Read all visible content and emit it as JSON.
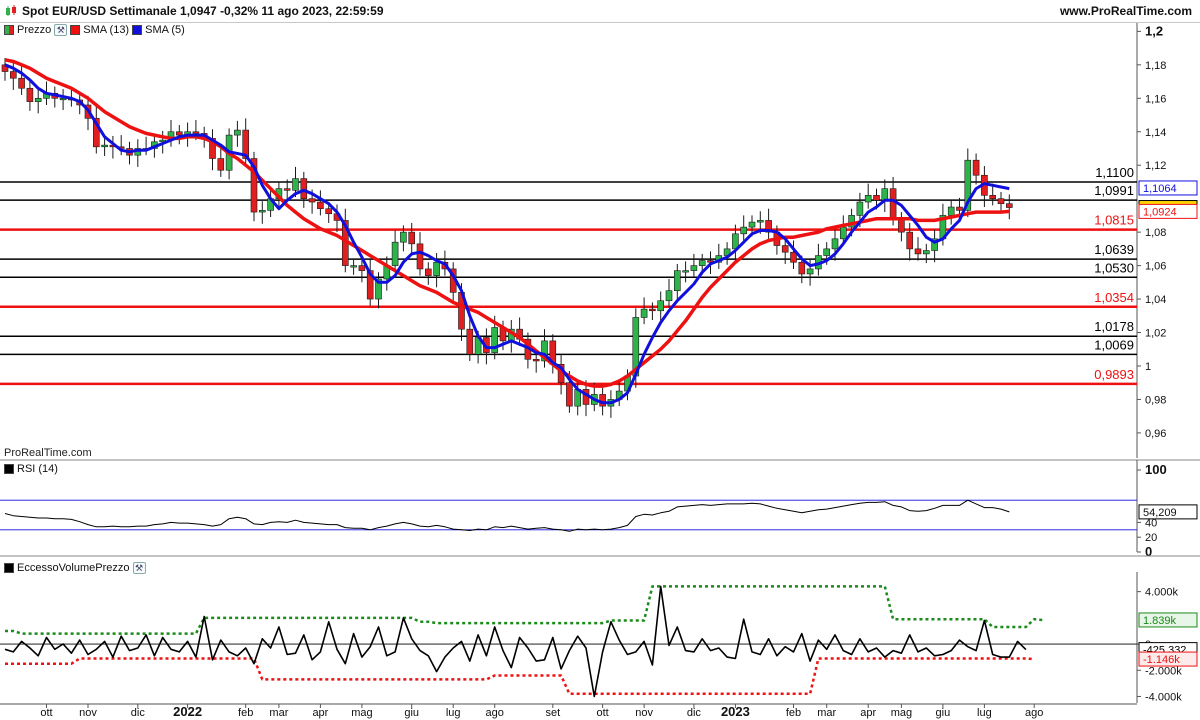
{
  "header": {
    "title": "Spot EUR/USD Settimanale 1,0947 -0,32% 11 ago 2023, 22:59:59",
    "site": "www.ProRealTime.com"
  },
  "watermark": "ProRealTime.com",
  "legends": {
    "price": "Prezzo",
    "sma13": "SMA (13)",
    "sma5": "SMA (5)",
    "rsi": "RSI (14)",
    "evp": "EccessoVolumePrezzo"
  },
  "colors": {
    "up_candle": "#2db34a",
    "down_candle": "#e02020",
    "sma13": "#ee1111",
    "sma5": "#1010dd",
    "support_red": "#ee1111",
    "level_black": "#000000",
    "evp_upper": "#1a8a1a",
    "evp_lower": "#ee1111"
  },
  "chart_data": [
    {
      "type": "candlestick",
      "panel": "price",
      "ylim": [
        0.945,
        1.205
      ],
      "y_ticks": [
        {
          "v": 1.2,
          "label": "1,2"
        },
        {
          "v": 1.18,
          "label": "1,18"
        },
        {
          "v": 1.16,
          "label": "1,16"
        },
        {
          "v": 1.14,
          "label": "1,14"
        },
        {
          "v": 1.12,
          "label": "1,12"
        },
        {
          "v": 1.08,
          "label": "1,08"
        },
        {
          "v": 1.06,
          "label": "1,06"
        },
        {
          "v": 1.04,
          "label": "1,04"
        },
        {
          "v": 1.02,
          "label": "1,02"
        },
        {
          "v": 1.0,
          "label": "1"
        },
        {
          "v": 0.98,
          "label": "0,98"
        },
        {
          "v": 0.96,
          "label": "0,96"
        }
      ],
      "levels": [
        {
          "v": 1.11,
          "label": "1,1100",
          "color": "#000000"
        },
        {
          "v": 1.0991,
          "label": "1,0991",
          "color": "#000000"
        },
        {
          "v": 1.0815,
          "label": "1,0815",
          "color": "#ee1111"
        },
        {
          "v": 1.0639,
          "label": "1,0639",
          "color": "#000000"
        },
        {
          "v": 1.053,
          "label": "1,0530",
          "color": "#000000"
        },
        {
          "v": 1.0354,
          "label": "1,0354",
          "color": "#ee1111"
        },
        {
          "v": 1.0178,
          "label": "1,0178",
          "color": "#000000"
        },
        {
          "v": 1.0069,
          "label": "1,0069",
          "color": "#000000"
        },
        {
          "v": 0.9893,
          "label": "0,9893",
          "color": "#ee1111"
        }
      ],
      "badges": [
        {
          "v": 1.1064,
          "label": "1,1064",
          "color": "#1010dd",
          "bold": false
        },
        {
          "v": 1.0947,
          "label": "1,0947",
          "color": "#000000",
          "bold": true,
          "bg": "#ffd400"
        },
        {
          "v": 1.0924,
          "label": "1,0924",
          "color": "#ee1111",
          "bold": false
        }
      ],
      "x_labels": [
        {
          "i": 5,
          "label": "ott",
          "bold": false
        },
        {
          "i": 10,
          "label": "nov",
          "bold": false
        },
        {
          "i": 16,
          "label": "dic",
          "bold": false
        },
        {
          "i": 22,
          "label": "2022",
          "bold": true
        },
        {
          "i": 29,
          "label": "feb",
          "bold": false
        },
        {
          "i": 33,
          "label": "mar",
          "bold": false
        },
        {
          "i": 38,
          "label": "apr",
          "bold": false
        },
        {
          "i": 43,
          "label": "mag",
          "bold": false
        },
        {
          "i": 49,
          "label": "giu",
          "bold": false
        },
        {
          "i": 54,
          "label": "lug",
          "bold": false
        },
        {
          "i": 59,
          "label": "ago",
          "bold": false
        },
        {
          "i": 66,
          "label": "set",
          "bold": false
        },
        {
          "i": 72,
          "label": "ott",
          "bold": false
        },
        {
          "i": 77,
          "label": "nov",
          "bold": false
        },
        {
          "i": 83,
          "label": "dic",
          "bold": false
        },
        {
          "i": 88,
          "label": "2023",
          "bold": true
        },
        {
          "i": 95,
          "label": "feb",
          "bold": false
        },
        {
          "i": 99,
          "label": "mar",
          "bold": false
        },
        {
          "i": 104,
          "label": "apr",
          "bold": false
        },
        {
          "i": 108,
          "label": "mag",
          "bold": false
        },
        {
          "i": 113,
          "label": "giu",
          "bold": false
        },
        {
          "i": 118,
          "label": "lug",
          "bold": false
        },
        {
          "i": 124,
          "label": "ago",
          "bold": false
        }
      ],
      "close": [
        1.176,
        1.172,
        1.166,
        1.158,
        1.16,
        1.163,
        1.16,
        1.16,
        1.159,
        1.156,
        1.148,
        1.131,
        1.132,
        1.131,
        1.13,
        1.126,
        1.13,
        1.13,
        1.134,
        1.135,
        1.14,
        1.138,
        1.14,
        1.139,
        1.136,
        1.124,
        1.117,
        1.138,
        1.141,
        1.124,
        1.092,
        1.093,
        1.1,
        1.106,
        1.105,
        1.112,
        1.1,
        1.098,
        1.094,
        1.091,
        1.087,
        1.06,
        1.06,
        1.057,
        1.04,
        1.052,
        1.06,
        1.074,
        1.08,
        1.073,
        1.058,
        1.054,
        1.062,
        1.058,
        1.044,
        1.022,
        1.007,
        1.017,
        1.008,
        1.023,
        1.015,
        1.022,
        1.016,
        1.004,
        1.003,
        1.015,
        1.001,
        0.99,
        0.976,
        0.986,
        0.977,
        0.983,
        0.976,
        0.98,
        0.985,
        0.994,
        1.029,
        1.034,
        1.033,
        1.039,
        1.045,
        1.057,
        1.057,
        1.06,
        1.063,
        1.062,
        1.066,
        1.07,
        1.079,
        1.083,
        1.086,
        1.087,
        1.08,
        1.072,
        1.068,
        1.062,
        1.055,
        1.058,
        1.066,
        1.07,
        1.076,
        1.083,
        1.09,
        1.098,
        1.102,
        1.099,
        1.106,
        1.088,
        1.08,
        1.07,
        1.067,
        1.069,
        1.076,
        1.09,
        1.095,
        1.093,
        1.123,
        1.114,
        1.102,
        1.1,
        1.097,
        1.0947
      ],
      "sma5": [
        1.18,
        1.178,
        1.175,
        1.171,
        1.166,
        1.163,
        1.162,
        1.161,
        1.16,
        1.158,
        1.153,
        1.145,
        1.137,
        1.133,
        1.129,
        1.128,
        1.129,
        1.129,
        1.131,
        1.133,
        1.135,
        1.137,
        1.138,
        1.138,
        1.138,
        1.135,
        1.132,
        1.128,
        1.127,
        1.126,
        1.119,
        1.108,
        1.1,
        1.094,
        1.099,
        1.103,
        1.105,
        1.103,
        1.1,
        1.097,
        1.092,
        1.084,
        1.074,
        1.065,
        1.055,
        1.05,
        1.05,
        1.054,
        1.062,
        1.067,
        1.068,
        1.066,
        1.063,
        1.061,
        1.054,
        1.045,
        1.03,
        1.018,
        1.011,
        1.011,
        1.013,
        1.015,
        1.013,
        1.011,
        1.008,
        1.007,
        1.002,
        0.999,
        0.992,
        0.986,
        0.983,
        0.98,
        0.978,
        0.978,
        0.98,
        0.984,
        0.995,
        1.007,
        1.017,
        1.026,
        1.033,
        1.039,
        1.044,
        1.049,
        1.056,
        1.061,
        1.063,
        1.065,
        1.069,
        1.074,
        1.079,
        1.081,
        1.081,
        1.08,
        1.076,
        1.07,
        1.064,
        1.06,
        1.061,
        1.063,
        1.067,
        1.073,
        1.08,
        1.086,
        1.092,
        1.095,
        1.099,
        1.099,
        1.096,
        1.09,
        1.084,
        1.077,
        1.074,
        1.076,
        1.082,
        1.087,
        1.098,
        1.106,
        1.109,
        1.108,
        1.107,
        1.106
      ],
      "sma13": [
        1.183,
        1.182,
        1.18,
        1.178,
        1.175,
        1.172,
        1.17,
        1.168,
        1.166,
        1.163,
        1.16,
        1.156,
        1.152,
        1.149,
        1.146,
        1.143,
        1.141,
        1.139,
        1.138,
        1.137,
        1.136,
        1.136,
        1.137,
        1.137,
        1.136,
        1.134,
        1.131,
        1.127,
        1.124,
        1.12,
        1.116,
        1.111,
        1.106,
        1.101,
        1.096,
        1.092,
        1.088,
        1.085,
        1.082,
        1.08,
        1.078,
        1.075,
        1.072,
        1.069,
        1.066,
        1.063,
        1.06,
        1.057,
        1.054,
        1.051,
        1.048,
        1.046,
        1.044,
        1.041,
        1.038,
        1.036,
        1.034,
        1.032,
        1.029,
        1.026,
        1.023,
        1.02,
        1.017,
        1.013,
        1.009,
        1.005,
        1.001,
        0.997,
        0.994,
        0.991,
        0.989,
        0.988,
        0.988,
        0.989,
        0.991,
        0.994,
        0.998,
        1.002,
        1.006,
        1.01,
        1.015,
        1.021,
        1.027,
        1.034,
        1.041,
        1.047,
        1.052,
        1.057,
        1.062,
        1.066,
        1.07,
        1.073,
        1.075,
        1.076,
        1.077,
        1.077,
        1.078,
        1.079,
        1.08,
        1.082,
        1.083,
        1.084,
        1.085,
        1.086,
        1.087,
        1.088,
        1.088,
        1.088,
        1.088,
        1.088,
        1.087,
        1.087,
        1.087,
        1.088,
        1.089,
        1.09,
        1.091,
        1.092,
        1.092,
        1.092,
        1.092,
        1.0924
      ]
    },
    {
      "type": "line",
      "panel": "rsi",
      "name": "RSI (14)",
      "ylim": [
        0,
        100
      ],
      "y_ticks": [
        {
          "v": 100,
          "label": "100"
        },
        {
          "v": 40,
          "label": "40"
        },
        {
          "v": 20,
          "label": "20"
        },
        {
          "v": 0,
          "label": "0"
        }
      ],
      "bands": [
        70,
        30
      ],
      "last_label": "54,209",
      "values": [
        52,
        49,
        48,
        47,
        46,
        46,
        45,
        45,
        44,
        41,
        37,
        34,
        34,
        35,
        34,
        34,
        35,
        35,
        37,
        38,
        40,
        39,
        39,
        38,
        37,
        35,
        37,
        45,
        47,
        45,
        38,
        37,
        40,
        41,
        40,
        43,
        40,
        39,
        38,
        37,
        37,
        33,
        32,
        32,
        30,
        33,
        35,
        38,
        40,
        38,
        35,
        34,
        36,
        34,
        31,
        30,
        29,
        31,
        30,
        34,
        33,
        35,
        33,
        31,
        32,
        33,
        31,
        30,
        28,
        31,
        30,
        31,
        30,
        31,
        33,
        36,
        48,
        51,
        50,
        53,
        55,
        61,
        62,
        63,
        64,
        63,
        64,
        65,
        65,
        65,
        66,
        65,
        62,
        59,
        57,
        55,
        53,
        55,
        57,
        58,
        60,
        62,
        64,
        66,
        67,
        67,
        68,
        63,
        61,
        56,
        55,
        56,
        59,
        63,
        63,
        63,
        70,
        65,
        60,
        60,
        58,
        54.209
      ]
    },
    {
      "type": "line",
      "panel": "evp",
      "name": "EccessoVolumePrezzo",
      "ylim": [
        -4500,
        5500
      ],
      "y_ticks": [
        {
          "v": 4000,
          "label": "4.000k"
        },
        {
          "v": 0,
          "label": "0"
        },
        {
          "v": -2000,
          "label": "-2.000k"
        },
        {
          "v": -4000,
          "label": "-4.000k"
        }
      ],
      "badges": [
        {
          "v": 1839,
          "label": "1.839k",
          "color": "#1a8a1a"
        },
        {
          "v": -425.332,
          "label": "-425.332",
          "color": "#000000"
        },
        {
          "v": -1146,
          "label": "-1.146k",
          "color": "#ee1111"
        }
      ],
      "values": [
        -400,
        -600,
        200,
        -300,
        -900,
        500,
        -400,
        0,
        -700,
        300,
        -800,
        -400,
        200,
        -1000,
        600,
        -500,
        -300,
        700,
        -900,
        500,
        -400,
        -600,
        200,
        -1000,
        2100,
        -1200,
        300,
        -600,
        -900,
        -300,
        -1500,
        400,
        -300,
        1300,
        -800,
        -700,
        700,
        -1200,
        -600,
        1700,
        -400,
        -1500,
        800,
        -1000,
        -200,
        1300,
        -900,
        -600,
        2000,
        400,
        -500,
        -900,
        -2100,
        -1000,
        -300,
        200,
        -1300,
        700,
        -900,
        1300,
        -500,
        -1800,
        500,
        -300,
        -1300,
        -1200,
        500,
        -1900,
        -500,
        600,
        -300,
        -4000,
        -600,
        1700,
        300,
        -800,
        -600,
        200,
        -1600,
        4400,
        -100,
        1300,
        -500,
        -600,
        400,
        -500,
        -300,
        -1000,
        -1100,
        1900,
        -600,
        -800,
        400,
        -900,
        -200,
        -600,
        800,
        -1300,
        300,
        -400,
        700,
        -500,
        -800,
        400,
        -600,
        -300,
        -1000,
        -500,
        -700,
        700,
        -600,
        -300,
        -900,
        -800,
        -500,
        300,
        -200,
        -500,
        1800,
        -800,
        -1000,
        -1000,
        200,
        -425.332
      ],
      "upper": [
        1000,
        1000,
        800,
        800,
        800,
        800,
        800,
        800,
        800,
        800,
        800,
        800,
        800,
        800,
        800,
        800,
        800,
        800,
        800,
        800,
        800,
        800,
        800,
        800,
        2000,
        2000,
        2000,
        2000,
        2000,
        2000,
        2000,
        2000,
        2000,
        2000,
        2000,
        2000,
        2000,
        2000,
        2000,
        2000,
        2000,
        2000,
        2000,
        2000,
        2000,
        2000,
        2000,
        2000,
        2000,
        2000,
        1700,
        1700,
        1600,
        1600,
        1600,
        1600,
        1600,
        1600,
        1600,
        1600,
        1600,
        1600,
        1600,
        1600,
        1600,
        1600,
        1600,
        1600,
        1600,
        1600,
        1600,
        1600,
        1600,
        1800,
        1800,
        1800,
        1800,
        1800,
        4400,
        4400,
        4400,
        4400,
        4400,
        4400,
        4400,
        4400,
        4400,
        4400,
        4400,
        4400,
        4400,
        4400,
        4400,
        4400,
        4400,
        4400,
        4400,
        4400,
        4400,
        4400,
        4400,
        4400,
        4400,
        4400,
        4400,
        4400,
        4400,
        1900,
        1900,
        1900,
        1900,
        1900,
        1900,
        1900,
        1900,
        1900,
        1900,
        1900,
        1900,
        1300,
        1300,
        1300,
        1300,
        1300,
        1900,
        1839
      ],
      "lower": [
        -1500,
        -1500,
        -1500,
        -1500,
        -1500,
        -1500,
        -1500,
        -1500,
        -1500,
        -1100,
        -1100,
        -1100,
        -1100,
        -1100,
        -1100,
        -1100,
        -1100,
        -1100,
        -1100,
        -1100,
        -1100,
        -1100,
        -1100,
        -1100,
        -1100,
        -1100,
        -1100,
        -1100,
        -1100,
        -1100,
        -1100,
        -2700,
        -2700,
        -2700,
        -2700,
        -2700,
        -2700,
        -2700,
        -2700,
        -2700,
        -2700,
        -2700,
        -2700,
        -2700,
        -2700,
        -2700,
        -2700,
        -2700,
        -2700,
        -2700,
        -2700,
        -2700,
        -2700,
        -2700,
        -2700,
        -2700,
        -2700,
        -2700,
        -2700,
        -2400,
        -2400,
        -2400,
        -2400,
        -2400,
        -2400,
        -2400,
        -2400,
        -2400,
        -3800,
        -3800,
        -3800,
        -3800,
        -3800,
        -3800,
        -3800,
        -3800,
        -3800,
        -3800,
        -3800,
        -3800,
        -3800,
        -3800,
        -3800,
        -3800,
        -3800,
        -3800,
        -3800,
        -3800,
        -3800,
        -3800,
        -3800,
        -3800,
        -3800,
        -3800,
        -3800,
        -3800,
        -3800,
        -3800,
        -1100,
        -1100,
        -1100,
        -1100,
        -1100,
        -1100,
        -1100,
        -1100,
        -1100,
        -1100,
        -1100,
        -1100,
        -1100,
        -1100,
        -1100,
        -1100,
        -1100,
        -1100,
        -1100,
        -1100,
        -1100,
        -1100,
        -1100,
        -1100,
        -1100,
        -1100,
        -1146
      ]
    }
  ]
}
